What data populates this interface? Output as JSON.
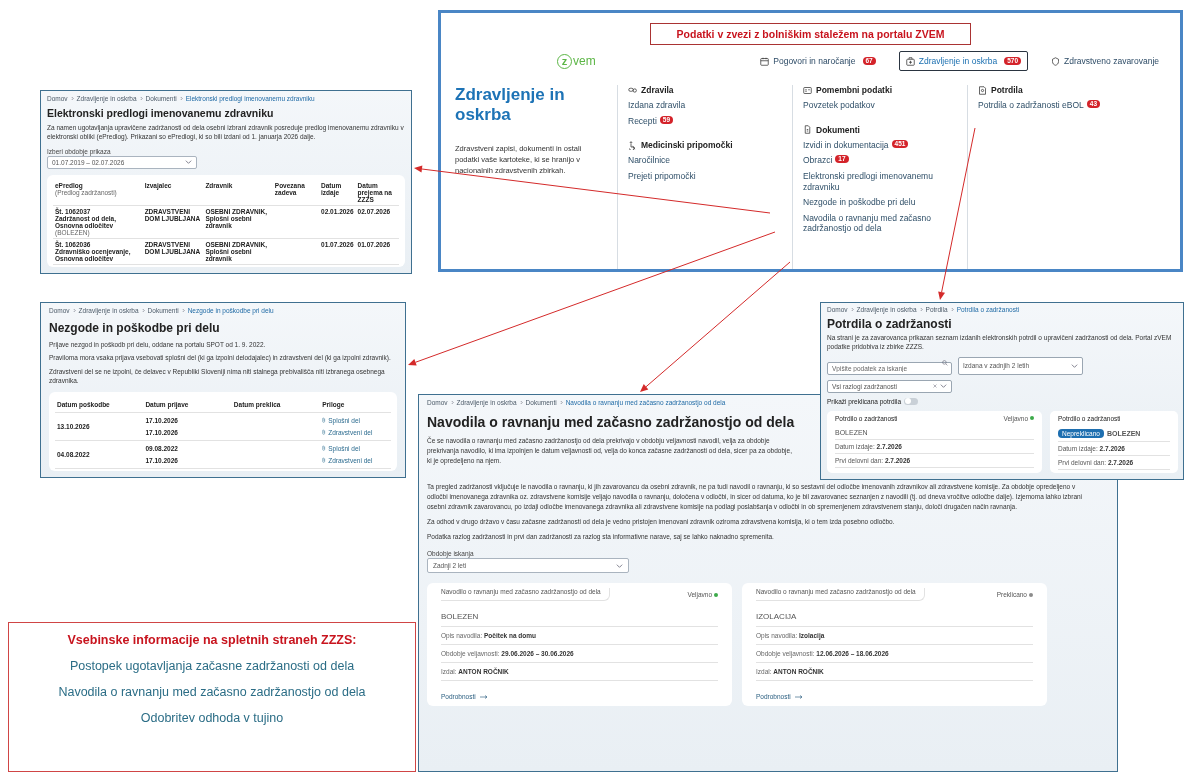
{
  "portal": {
    "banner": "Podatki v zvezi z bolniškim staležem na portalu ZVEM",
    "logo": {
      "letter": "z",
      "text": "vem"
    },
    "nav": [
      {
        "label": "Pogovori in naročanje",
        "badge": "67",
        "selected": false
      },
      {
        "label": "Zdravljenje in oskrba",
        "badge": "570",
        "selected": true
      },
      {
        "label": "Zdravstveno zavarovanje",
        "selected": false
      }
    ],
    "heading": "Zdravljenje in oskrba",
    "description": "Zdravstveni zapisi, dokumenti in ostali podatki vaše kartoteke, ki se hranijo v nacionalnih zdravstvenih zbirkah.",
    "columns": [
      [
        {
          "title": "Zdravila",
          "items": [
            {
              "label": "Izdana zdravila"
            },
            {
              "label": "Recepti",
              "badge": "59"
            }
          ]
        },
        {
          "title": "Medicinski pripomočki",
          "items": [
            {
              "label": "Naročilnice"
            },
            {
              "label": "Prejeti pripomočki"
            }
          ]
        }
      ],
      [
        {
          "title": "Pomembni podatki",
          "items": [
            {
              "label": "Povzetek podatkov"
            }
          ]
        },
        {
          "title": "Dokumenti",
          "items": [
            {
              "label": "Izvidi in dokumentacija",
              "badge": "451"
            },
            {
              "label": "Obrazci",
              "badge": "17"
            },
            {
              "label": "Elektronski predlogi imenovanemu zdravniku"
            },
            {
              "label": "Nezgode in poškodbe pri delu"
            },
            {
              "label": "Navodila o ravnanju med začasno zadržanostjo od dela"
            }
          ]
        }
      ],
      [
        {
          "title": "Potrdila",
          "items": [
            {
              "label": "Potrdila o zadržanosti eBOL",
              "badge": "43"
            }
          ]
        }
      ]
    ]
  },
  "proposals_page": {
    "breadcrumb": [
      "Domov",
      "Zdravljenje in oskrba",
      "Dokumenti",
      "Elektronski predlogi imenovanemu zdravniku"
    ],
    "title": "Elektronski predlogi imenovanemu zdravniku",
    "intro": "Za namen ugotavljanja upravičene zadržanosti od dela osebni izbrani zdravnik posreduje predlog imenovanemu zdravniku v elektronski obliki (ePredlog). Prikazani so ePredlogi, ki so bili izdani od 1. januarja 2026 dalje.",
    "filter": {
      "label": "Izberi obdobje prikaza",
      "value": "01.07.2019 – 02.07.2026"
    },
    "columns": [
      {
        "label": "ePredlog",
        "sublabel": "(Predlog zadržanosti)"
      },
      {
        "label": "Izvajalec"
      },
      {
        "label": "Zdravnik"
      },
      {
        "label": "Povezana zadeva"
      },
      {
        "label": "Datum izdaje"
      },
      {
        "label": "Datum prejema na ZZZS"
      }
    ],
    "rows": [
      {
        "number": "Št. 1062037",
        "title": "Zadržanost od dela, Osnovna odločitev",
        "reason": "(BOLEZEN)",
        "provider": "ZDRAVSTVENI DOM LJUBLJANA",
        "doctor": "OSEBNI ZDRAVNIK, Splošni osebni zdravnik",
        "issued": "02.01.2026",
        "received": "02.07.2026"
      },
      {
        "number": "Št. 1062036",
        "title": "Zdravniško ocenjevanje, Osnovna odločitev",
        "provider": "ZDRAVSTVENI DOM LJUBLJANA",
        "doctor": "OSEBNI ZDRAVNIK, Splošni osebni zdravnik",
        "issued": "01.07.2026",
        "received": "01.07.2026"
      }
    ]
  },
  "injuries_page": {
    "breadcrumb": [
      "Domov",
      "Zdravljenje in oskrba",
      "Dokumenti",
      "Nezgode in poškodbe pri delu"
    ],
    "title": "Nezgode in poškodbe pri delu",
    "paragraphs": [
      "Prijave nezgod in poškodb pri delu, oddane na portalu SPOT od 1. 9. 2022.",
      "Praviloma mora vsaka prijava vsebovati splošni del (ki ga izpolni delodajalec) in zdravstveni del (ki ga izpolni zdravnik).",
      "Zdravstveni del se ne izpolni, če delavec v Republiki Sloveniji nima niti stalnega prebivališča niti izbranega osebnega zdravnika."
    ],
    "columns": [
      "Datum poškodbe",
      "Datum prijave",
      "Datum preklica",
      "Priloge"
    ],
    "rows": [
      {
        "date": "13.10.2026",
        "entries": [
          {
            "reported": "17.10.2026",
            "attachment": "Splošni del"
          },
          {
            "reported": "17.10.2026",
            "attachment": "Zdravstveni del"
          }
        ]
      },
      {
        "date": "04.08.2022",
        "entries": [
          {
            "reported": "09.08.2022",
            "attachment": "Splošni del"
          },
          {
            "reported": "17.10.2026",
            "attachment": "Zdravstveni del"
          }
        ]
      }
    ]
  },
  "certificates_page": {
    "breadcrumb": [
      "Domov",
      "Zdravljenje in oskrba",
      "Potrdila",
      "Potrdila o zadržanosti"
    ],
    "title": "Potrdila o zadržanosti",
    "description": "Na strani je za zavarovanca prikazan seznam izdanih elektronskih potrdil o upravičeni zadržanosti od dela. Portal zVEM podatke pridobiva iz zbirke ZZZS.",
    "search": {
      "placeholder": "Vpišite podatek za iskanje"
    },
    "period": {
      "value": "Izdana v zadnjih 2 letih"
    },
    "reason": {
      "value": "Vsi razlogi zadržanosti"
    },
    "toggle": {
      "label": "Prikaži preklicana potrdila",
      "on": false
    },
    "cards": [
      {
        "tab": "Potrdilo o zadržanosti",
        "status": "Veljavno",
        "color": "#3daa4a",
        "title": "BOLEZEN",
        "rows": [
          {
            "label": "Datum izdaje:",
            "value": "2.7.2026"
          },
          {
            "label": "Prvi delovni dan:",
            "value": "2.7.2026"
          }
        ]
      },
      {
        "tab": "Potrdilo o zadržanosti",
        "badge": "Nepreklicano",
        "title": "BOLEZEN",
        "rows": [
          {
            "label": "Datum izdaje:",
            "value": "2.7.2026"
          },
          {
            "label": "Prvi delovni dan:",
            "value": "2.7.2026"
          }
        ]
      }
    ]
  },
  "instructions_page": {
    "breadcrumb": [
      "Domov",
      "Zdravljenje in oskrba",
      "Dokumenti",
      "Navodila o ravnanju med začasno zadržanostjo od dela"
    ],
    "title": "Navodila o ravnanju med začasno zadržanostjo od dela",
    "paragraphs": [
      "Če se navodila o ravnanju med začasno zadržanostjo od dela prekrivajo v obdobju veljavnosti navodil, velja za obdobje prekrivanja navodilo, ki ima izpolnjen le datum veljavnosti od, velja do konca začasne zadržanosti od dela, sicer pa za obdobje, ki je opredeljeno na njem.",
      "Ta pregled zadržanosti vključuje le navodila o ravnanju, ki jih zavarovancu da osebni zdravnik, ne pa tudi navodil o ravnanju, ki so sestavni del odločbe imenovanih zdravnikov ali zdravstvene komisije. Za obdobje opredeljeno v odločbi imenovanega zdravnika oz. zdravstvene komisije veljajo navodila o ravnanju, določena v odločbi, in sicer od datuma, ko je bil zavarovanec seznanjen z navodili (tj. od dneva vročitve odločbe dalje). Izjemoma lahko izbrani osebni zdravnik zavarovancu, po izdaji odločbe imenovanega zdravnika ali zdravstvene komisije na podlagi poslabšanja v odločbi in ob spremenjenem zdravstvenem stanju, določi drugačen način ravnanja.",
      "Za odhod v drugo državo v času začasne zadržanosti od dela je vedno pristojen imenovani zdravnik oziroma zdravstvena komisija, ki o tem izda posebno odločbo.",
      "Podatka razlog zadržanosti in prvi dan zadržanosti za razlog sta informativne narave, saj se lahko naknadno spremenita."
    ],
    "filter": {
      "label": "Obdobje iskanja",
      "value": "Zadnji 2 leti"
    },
    "cards": [
      {
        "tab": "Navodilo o ravnanju med začasno zadržanostjo od dela",
        "status": "Veljavno",
        "color": "#3daa4a",
        "title": "BOLEZEN",
        "rows": [
          {
            "label": "Opis navodila:",
            "value": "Počitek na domu"
          },
          {
            "label": "Obdobje veljavnosti:",
            "value": "29.06.2026 – 30.06.2026"
          },
          {
            "label": "Izdal:",
            "value": "ANTON ROČNIK"
          }
        ],
        "link": "Podrobnosti"
      },
      {
        "tab": "Navodilo o ravnanju med začasno zadržanostjo od dela",
        "status": "Preklicano",
        "color": "#8c8c8c",
        "title": "IZOLACIJA",
        "rows": [
          {
            "label": "Opis navodila:",
            "value": "Izolacija"
          },
          {
            "label": "Obdobje veljavnosti:",
            "value": "12.06.2026 – 18.06.2026"
          },
          {
            "label": "Izdal:",
            "value": "ANTON ROČNIK"
          }
        ],
        "link": "Podrobnosti"
      }
    ]
  },
  "zzzs_info": {
    "title": "Vsebinske informacije na spletnih straneh ZZZS:",
    "links": [
      "Postopek ugotavljanja začasne zadržanosti od dela",
      "Navodila o ravnanju med začasno zadržanostjo od dela",
      "Odobritev odhoda v tujino"
    ]
  }
}
